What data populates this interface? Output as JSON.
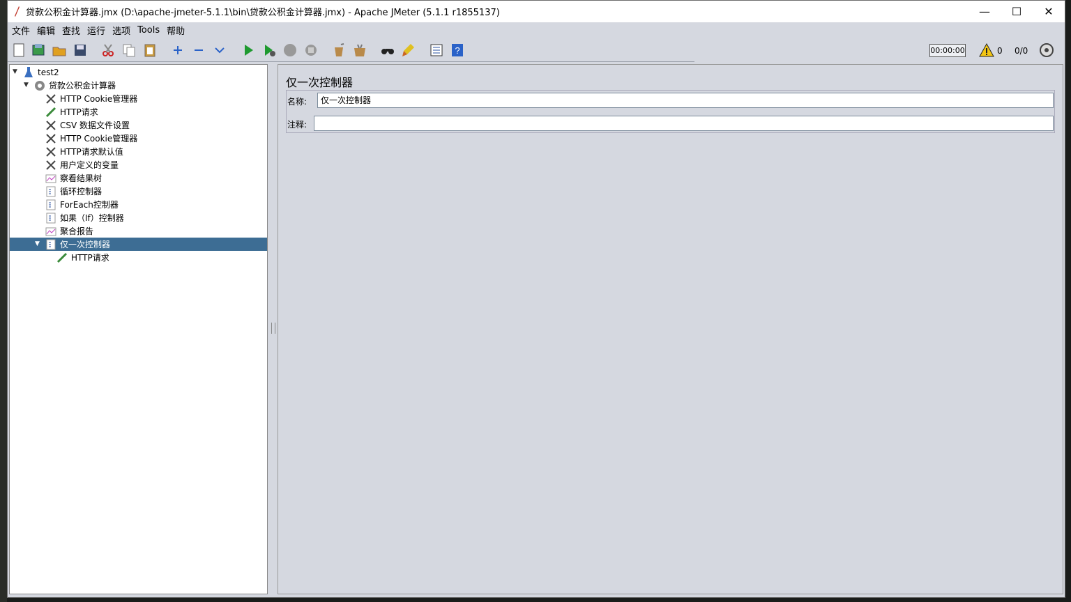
{
  "window": {
    "title": "贷款公积金计算器.jmx (D:\\apache-jmeter-5.1.1\\bin\\贷款公积金计算器.jmx) - Apache JMeter (5.1.1 r1855137)",
    "minimize": "—",
    "maximize": "☐",
    "close": "✕"
  },
  "menu": [
    "文件",
    "编辑",
    "查找",
    "运行",
    "选项",
    "Tools",
    "帮助"
  ],
  "toolbar": {
    "icons": [
      "new-icon",
      "templates-icon",
      "open-icon",
      "save-icon",
      "cut-icon",
      "copy-icon",
      "paste-icon",
      "expand-icon",
      "collapse-icon",
      "toggle-icon",
      "start-icon",
      "start-no-pause-icon",
      "stop-icon",
      "shutdown-icon",
      "clear-icon",
      "clear-all-icon",
      "search-icon",
      "reset-search-icon",
      "function-helper-icon",
      "help-icon"
    ],
    "timer": "00:00:00",
    "warning_count": "0",
    "thread_count": "0/0",
    "remote_icon": "remote-icon"
  },
  "tree": {
    "nodes": [
      {
        "label": "test2",
        "icon": "test-plan-icon"
      },
      {
        "label": "贷款公积金计算器",
        "icon": "thread-group-icon"
      },
      {
        "label": "HTTP Cookie管理器",
        "icon": "config-element-icon"
      },
      {
        "label": "HTTP请求",
        "icon": "sampler-icon"
      },
      {
        "label": "CSV 数据文件设置",
        "icon": "config-element-icon"
      },
      {
        "label": "HTTP Cookie管理器",
        "icon": "config-element-icon"
      },
      {
        "label": "HTTP请求默认值",
        "icon": "config-element-icon"
      },
      {
        "label": "用户定义的变量",
        "icon": "config-element-icon"
      },
      {
        "label": "察看结果树",
        "icon": "listener-icon"
      },
      {
        "label": "循环控制器",
        "icon": "controller-icon"
      },
      {
        "label": "ForEach控制器",
        "icon": "controller-icon"
      },
      {
        "label": "如果（If）控制器",
        "icon": "controller-icon"
      },
      {
        "label": "聚合报告",
        "icon": "listener-icon"
      },
      {
        "label": "仅一次控制器",
        "icon": "controller-icon",
        "selected": true
      },
      {
        "label": "HTTP请求",
        "icon": "sampler-icon"
      }
    ]
  },
  "editor": {
    "heading": "仅一次控制器",
    "name_label": "名称:",
    "name_value": "仅一次控制器",
    "comment_label": "注释:",
    "comment_value": ""
  },
  "colors": {
    "selection": "#3d6d94",
    "background": "#d5d8e0"
  }
}
